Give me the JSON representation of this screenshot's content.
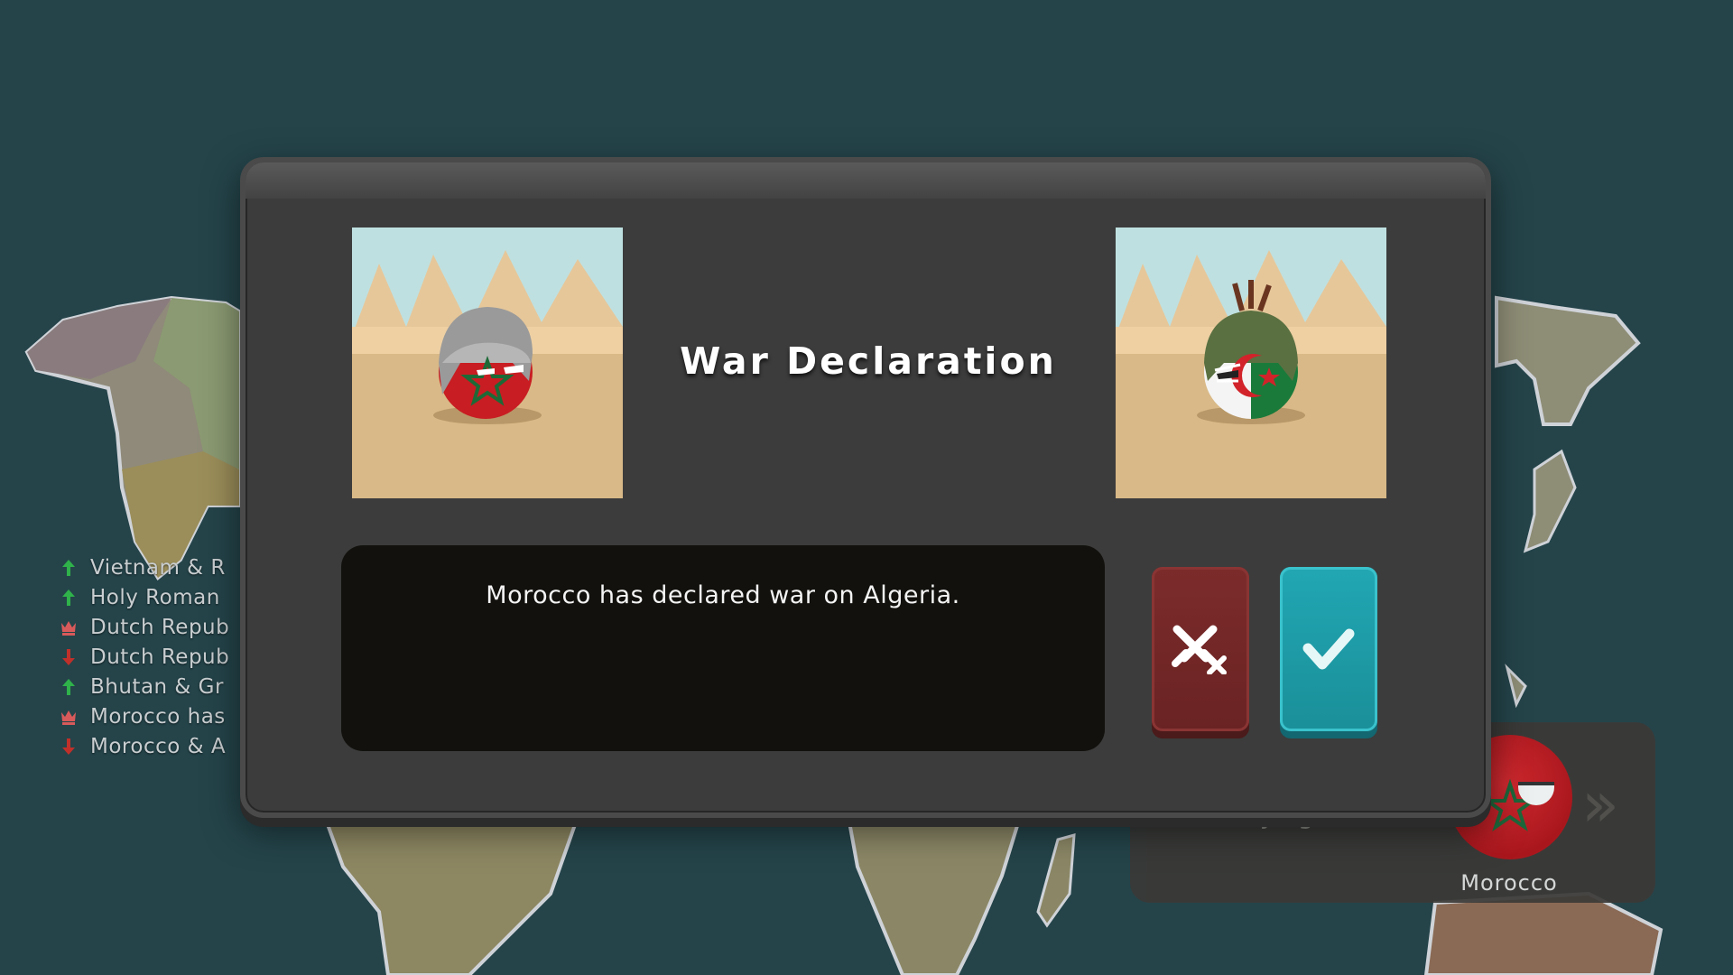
{
  "event_log": [
    {
      "icon": "arrow-up-icon",
      "text": "Vietnam & R"
    },
    {
      "icon": "arrow-up-icon",
      "text": "Holy Roman"
    },
    {
      "icon": "crown-icon",
      "text": "Dutch Repub"
    },
    {
      "icon": "arrow-down-icon",
      "text": "Dutch Repub"
    },
    {
      "icon": "arrow-up-icon",
      "text": "Bhutan & Gr"
    },
    {
      "icon": "crown-icon",
      "text": "Morocco has"
    },
    {
      "icon": "arrow-down-icon",
      "text": "Morocco & A"
    }
  ],
  "dialog": {
    "title": "War Declaration",
    "message": "Morocco has declared war on Algeria.",
    "attacker_portrait": "morocco-ball",
    "defender_portrait": "algeria-ball",
    "decline_icon": "crossed-swords-x-icon",
    "accept_icon": "checkmark-icon"
  },
  "player_panel": {
    "playing_label": "Playing:",
    "country": "Morocco",
    "next_icon": "double-chevron-right-icon"
  },
  "colors": {
    "ocean": "#24444a",
    "dialog_bg": "#3c3c3c",
    "decline": "#7c2b2b",
    "accept": "#21a7b3",
    "arrow_up": "#2fb24a",
    "arrow_down": "#c0302a"
  }
}
